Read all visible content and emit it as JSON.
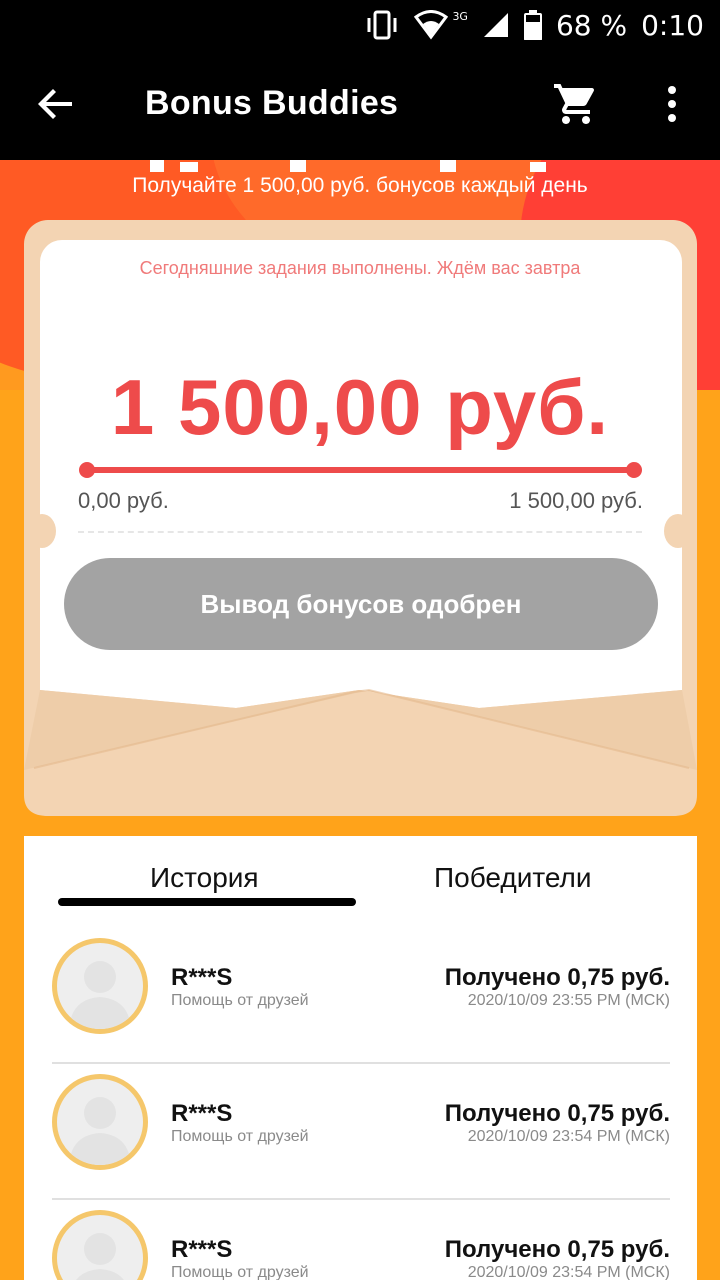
{
  "status_bar": {
    "battery": "68 %",
    "time": "0:10",
    "network": "3G",
    "icons": [
      "vibrate-icon",
      "wifi-icon",
      "signal-icon",
      "battery-icon"
    ]
  },
  "app_bar": {
    "title": "Bonus Buddies",
    "icons": [
      "back-arrow-icon",
      "cart-icon",
      "more-vert-icon"
    ]
  },
  "hero": {
    "subtitle": "Получайте 1 500,00 руб. бонусов каждый день"
  },
  "card": {
    "notice": "Сегодняшние задания выполнены. Ждём вас завтра",
    "amount": "1 500,00 руб.",
    "progress_fraction": 1.0,
    "range_min": "0,00 руб.",
    "range_max": "1 500,00 руб.",
    "button_label": "Вывод бонусов одобрен"
  },
  "tabs": {
    "history": "История",
    "winners": "Победители",
    "active": "history"
  },
  "history": [
    {
      "name": "R***S",
      "source": "Помощь от друзей",
      "received": "Получено 0,75 руб.",
      "datetime": "2020/10/09 23:55 PM (МСК)"
    },
    {
      "name": "R***S",
      "source": "Помощь от друзей",
      "received": "Получено 0,75 руб.",
      "datetime": "2020/10/09 23:54 PM (МСК)"
    },
    {
      "name": "R***S",
      "source": "Помощь от друзей",
      "received": "Получено 0,75 руб.",
      "datetime": "2020/10/09 23:54 PM (МСК)"
    }
  ],
  "colors": {
    "accent_red": "#ee4b4b",
    "background_orange": "#ffa31a",
    "envelope": "#f3d4b3",
    "button_disabled": "#a3a3a3"
  }
}
